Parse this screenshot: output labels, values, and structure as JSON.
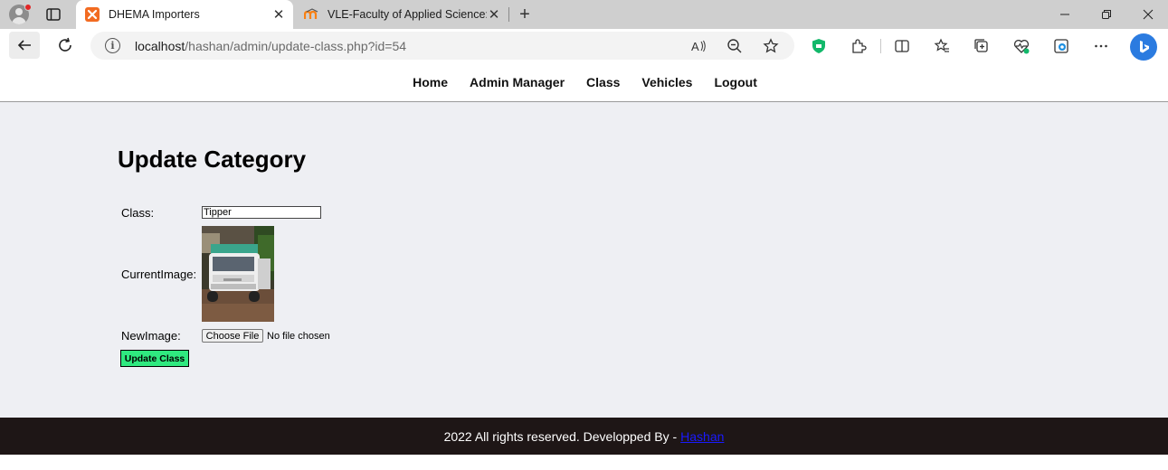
{
  "browser": {
    "tabs": [
      {
        "title": "DHEMA Importers",
        "active": true,
        "icon": "xampp-icon"
      },
      {
        "title": "VLE-Faculty of Applied Science: L",
        "active": false,
        "icon": "moodle-icon"
      }
    ],
    "address": {
      "host": "localhost",
      "path": "/hashan/admin/update-class.php?id=54"
    },
    "colors": {
      "tab_strip": "#cfcfcf",
      "toolbar": "#ffffff",
      "omnibox": "#f3f3f3"
    }
  },
  "nav": {
    "links": [
      "Home",
      "Admin Manager",
      "Class",
      "Vehicles",
      "Logout"
    ]
  },
  "page": {
    "title": "Update Category",
    "form": {
      "class_label": "Class:",
      "class_value": "Tipper",
      "current_image_label": "CurrentImage:",
      "new_image_label": "NewImage:",
      "file_button": "Choose File",
      "file_status": "No file chosen",
      "submit_label": "Update Class"
    },
    "colors": {
      "background": "#eeeff3",
      "submit": "#2fe97f"
    }
  },
  "footer": {
    "text": "2022 All rights reserved. Developped By -",
    "link": "Hashan",
    "colors": {
      "background": "#1e1616",
      "link": "#1a1aff"
    }
  }
}
